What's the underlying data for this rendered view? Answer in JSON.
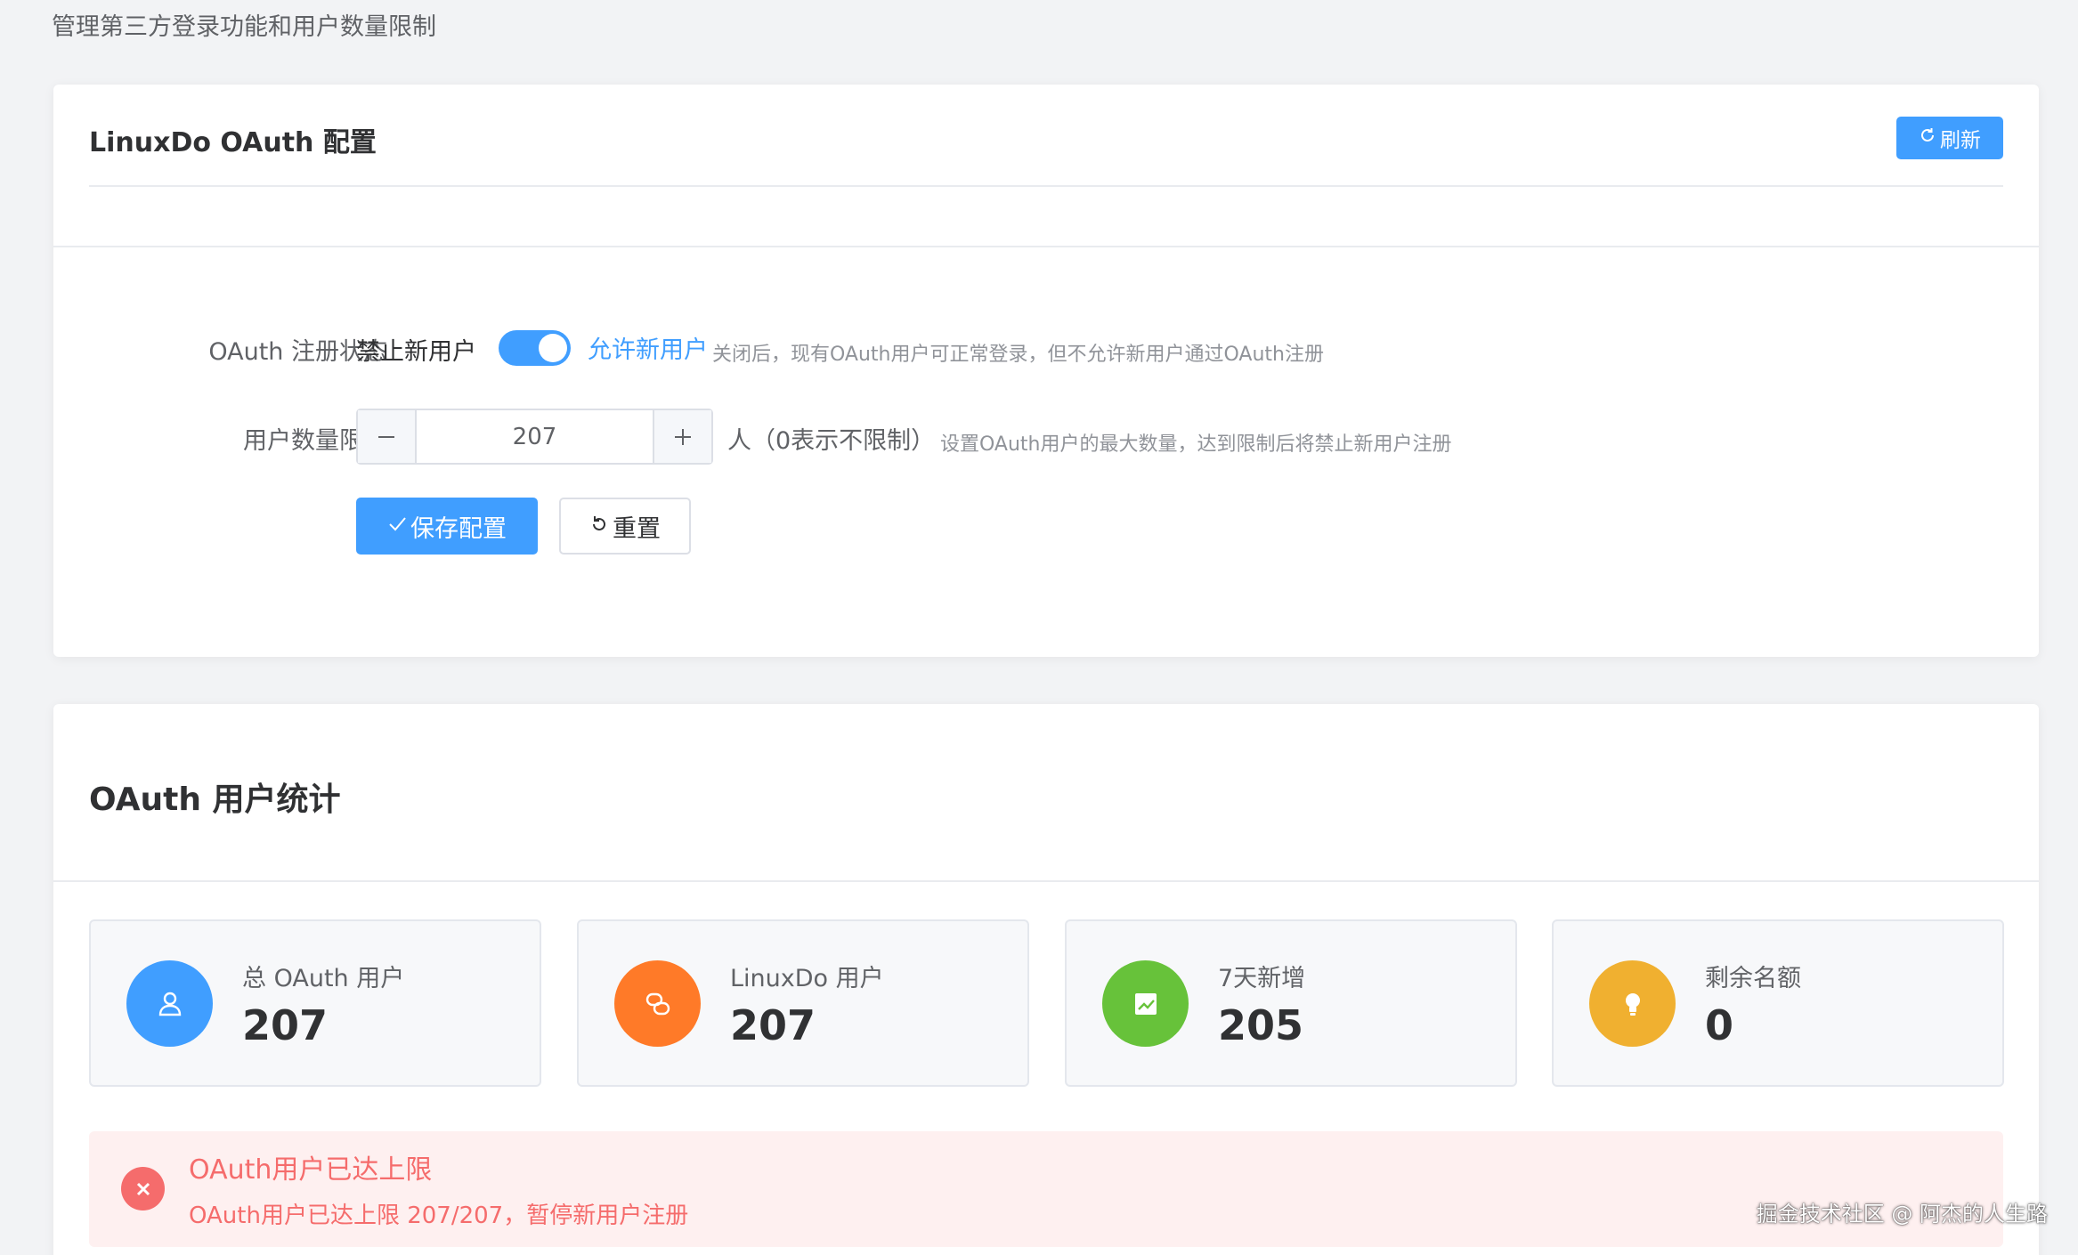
{
  "page": {
    "subtitle": "管理第三方登录功能和用户数量限制"
  },
  "config_card": {
    "title": "LinuxDo OAuth 配置",
    "refresh_label": "刷新",
    "oauth_status_label": "OAuth 注册状态",
    "switch_off_label": "禁止新用户",
    "switch_on_label": "允许新用户",
    "switch_enabled": true,
    "switch_hint": "关闭后，现有OAuth用户可正常登录，但不允许新用户通过OAuth注册",
    "limit_label": "用户数量限制",
    "limit_value": "207",
    "limit_unit": "人（0表示不限制）",
    "limit_hint": "设置OAuth用户的最大数量，达到限制后将禁止新用户注册",
    "save_label": "保存配置",
    "reset_label": "重置"
  },
  "stats_card": {
    "title": "OAuth 用户统计",
    "stats": [
      {
        "label": "总 OAuth 用户",
        "value": "207",
        "icon": "user-icon",
        "color": "#409eff"
      },
      {
        "label": "LinuxDo 用户",
        "value": "207",
        "icon": "link-icon",
        "color": "#ff7a28"
      },
      {
        "label": "7天新增",
        "value": "205",
        "icon": "trend-chart-icon",
        "color": "#67c23a"
      },
      {
        "label": "剩余名额",
        "value": "0",
        "icon": "lightbulb-icon",
        "color": "#f0b030"
      }
    ],
    "alert": {
      "title": "OAuth用户已达上限",
      "description": "OAuth用户已达上限 207/207，暂停新用户注册"
    }
  },
  "watermark": "掘金技术社区 @ 阿杰的人生路"
}
